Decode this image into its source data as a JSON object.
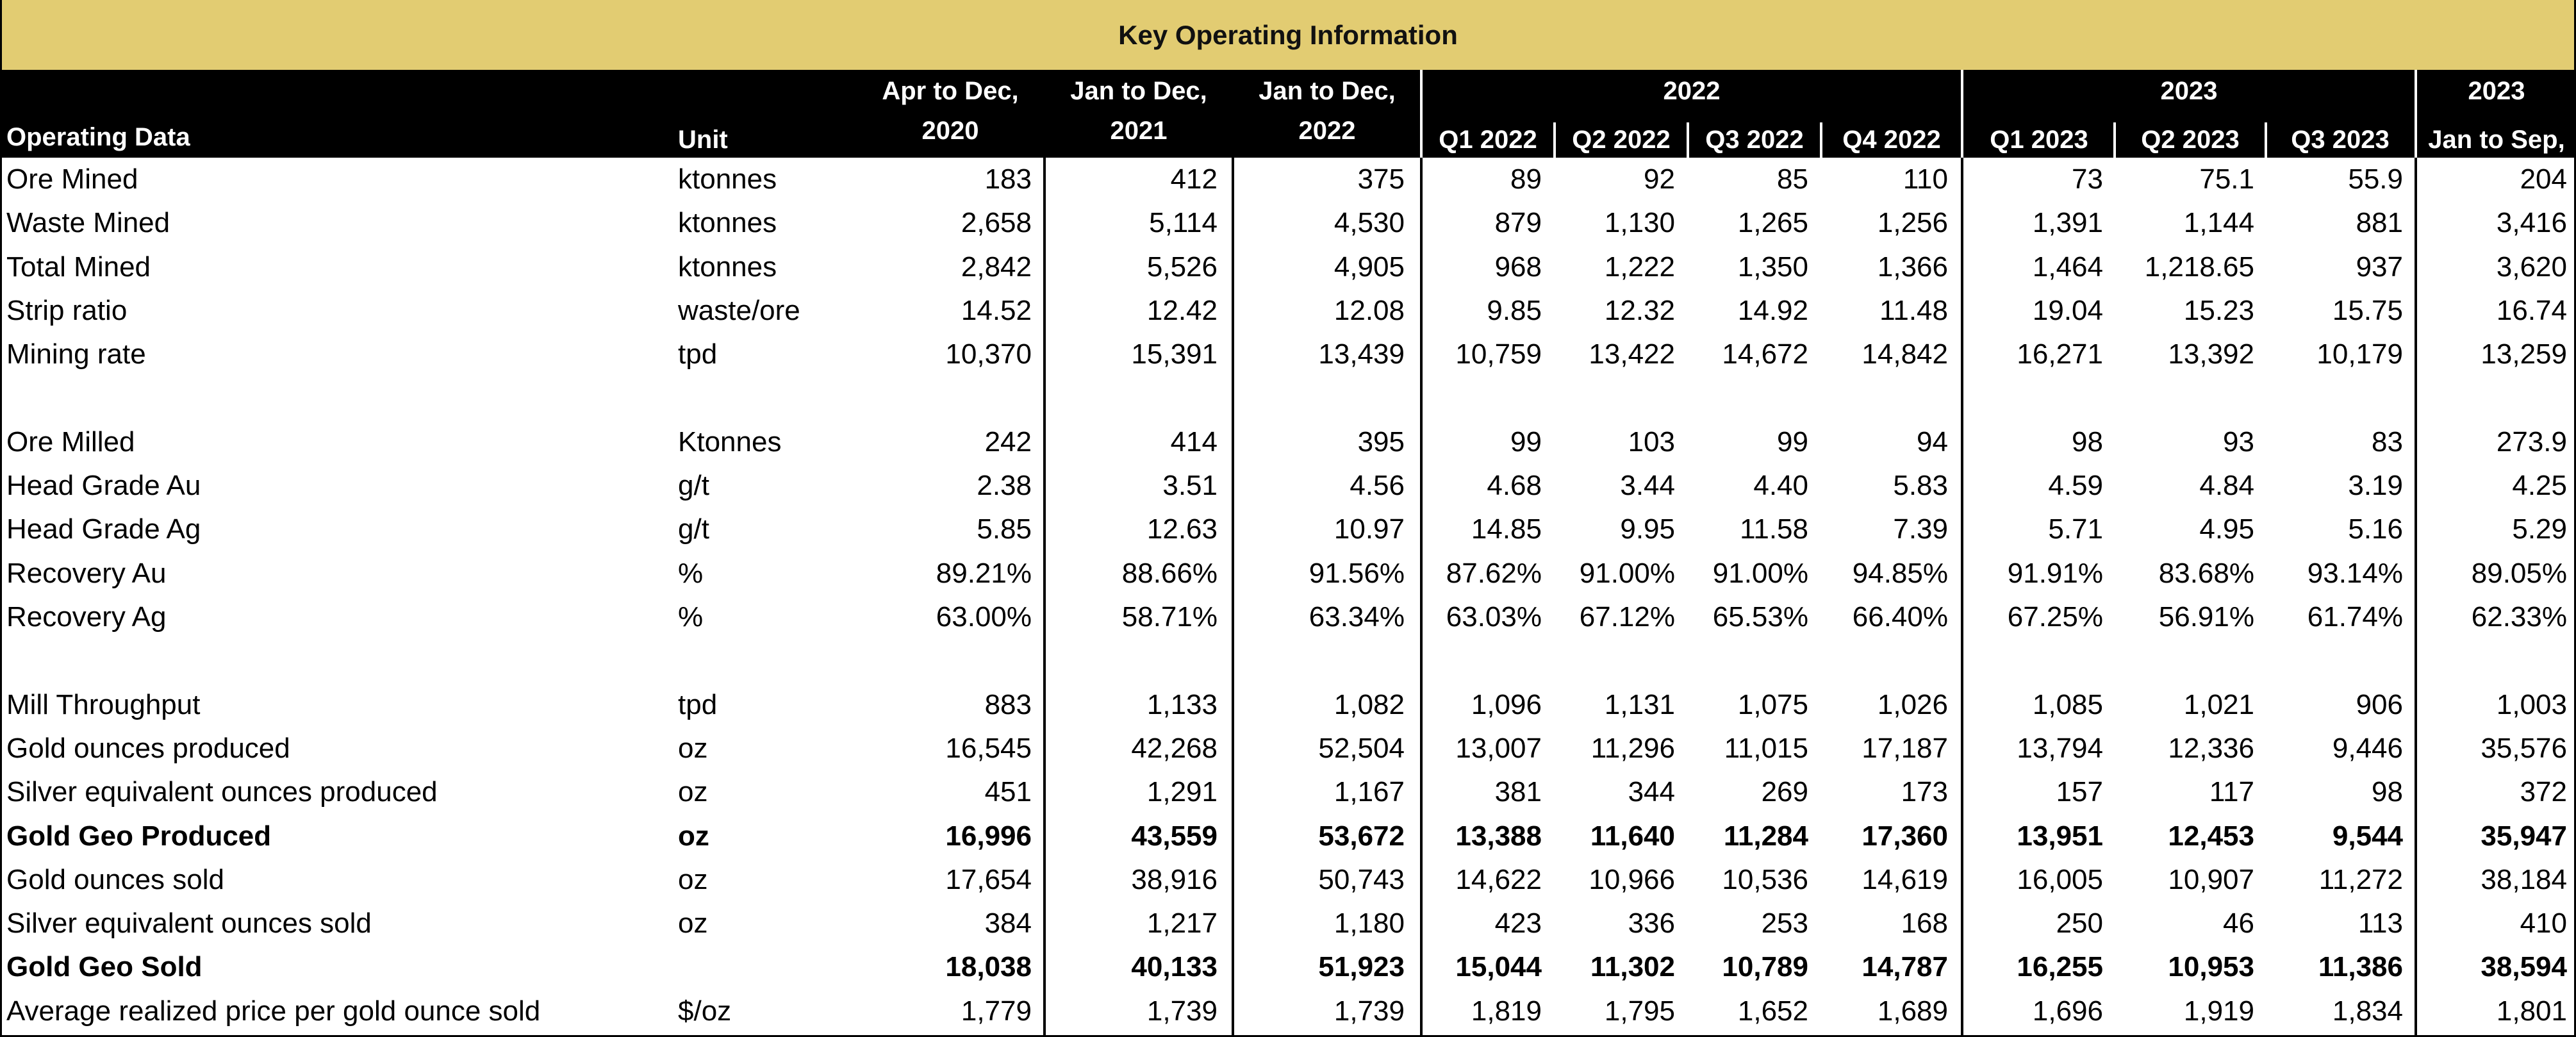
{
  "title": "Key Operating Information",
  "headers": {
    "operating_data": "Operating Data",
    "unit": "Unit",
    "apr_dec_2020": [
      "Apr to Dec,",
      "2020"
    ],
    "jan_dec_2021": [
      "Jan to Dec,",
      "2021"
    ],
    "jan_dec_2022": [
      "Jan to Dec,",
      "2022"
    ],
    "group_2022": "2022",
    "group_2023": "2023",
    "group_2023_ytd": "2023",
    "quarters": [
      "Q1 2022",
      "Q2 2022",
      "Q3 2022",
      "Q4 2022",
      "Q1 2023",
      "Q2 2023",
      "Q3 2023"
    ],
    "jan_sep": "Jan to Sep,"
  },
  "rows": [
    {
      "label": "Ore Mined",
      "unit": "ktonnes",
      "bold": false,
      "values": [
        "183",
        "412",
        "375",
        "89",
        "92",
        "85",
        "110",
        "73",
        "75.1",
        "55.9",
        "204"
      ]
    },
    {
      "label": "Waste Mined",
      "unit": "ktonnes",
      "bold": false,
      "values": [
        "2,658",
        "5,114",
        "4,530",
        "879",
        "1,130",
        "1,265",
        "1,256",
        "1,391",
        "1,144",
        "881",
        "3,416"
      ]
    },
    {
      "label": "Total Mined",
      "unit": "ktonnes",
      "bold": false,
      "values": [
        "2,842",
        "5,526",
        "4,905",
        "968",
        "1,222",
        "1,350",
        "1,366",
        "1,464",
        "1,218.65",
        "937",
        "3,620"
      ]
    },
    {
      "label": "Strip ratio",
      "unit": "waste/ore",
      "bold": false,
      "values": [
        "14.52",
        "12.42",
        "12.08",
        "9.85",
        "12.32",
        "14.92",
        "11.48",
        "19.04",
        "15.23",
        "15.75",
        "16.74"
      ]
    },
    {
      "label": "Mining rate",
      "unit": "tpd",
      "bold": false,
      "values": [
        "10,370",
        "15,391",
        "13,439",
        "10,759",
        "13,422",
        "14,672",
        "14,842",
        "16,271",
        "13,392",
        "10,179",
        "13,259"
      ]
    },
    {
      "label": "",
      "unit": "",
      "bold": false,
      "values": [
        "",
        "",
        "",
        "",
        "",
        "",
        "",
        "",
        "",
        "",
        ""
      ]
    },
    {
      "label": "Ore Milled",
      "unit": "Ktonnes",
      "bold": false,
      "values": [
        "242",
        "414",
        "395",
        "99",
        "103",
        "99",
        "94",
        "98",
        "93",
        "83",
        "273.9"
      ]
    },
    {
      "label": "Head Grade Au",
      "unit": "g/t",
      "bold": false,
      "values": [
        "2.38",
        "3.51",
        "4.56",
        "4.68",
        "3.44",
        "4.40",
        "5.83",
        "4.59",
        "4.84",
        "3.19",
        "4.25"
      ]
    },
    {
      "label": "Head Grade Ag",
      "unit": "g/t",
      "bold": false,
      "values": [
        "5.85",
        "12.63",
        "10.97",
        "14.85",
        "9.95",
        "11.58",
        "7.39",
        "5.71",
        "4.95",
        "5.16",
        "5.29"
      ]
    },
    {
      "label": "Recovery Au",
      "unit": "%",
      "bold": false,
      "values": [
        "89.21%",
        "88.66%",
        "91.56%",
        "87.62%",
        "91.00%",
        "91.00%",
        "94.85%",
        "91.91%",
        "83.68%",
        "93.14%",
        "89.05%"
      ]
    },
    {
      "label": "Recovery Ag",
      "unit": "%",
      "bold": false,
      "values": [
        "63.00%",
        "58.71%",
        "63.34%",
        "63.03%",
        "67.12%",
        "65.53%",
        "66.40%",
        "67.25%",
        "56.91%",
        "61.74%",
        "62.33%"
      ]
    },
    {
      "label": "",
      "unit": "",
      "bold": false,
      "values": [
        "",
        "",
        "",
        "",
        "",
        "",
        "",
        "",
        "",
        "",
        ""
      ]
    },
    {
      "label": "Mill Throughput",
      "unit": "tpd",
      "bold": false,
      "values": [
        "883",
        "1,133",
        "1,082",
        "1,096",
        "1,131",
        "1,075",
        "1,026",
        "1,085",
        "1,021",
        "906",
        "1,003"
      ]
    },
    {
      "label": "Gold ounces produced",
      "unit": "oz",
      "bold": false,
      "values": [
        "16,545",
        "42,268",
        "52,504",
        "13,007",
        "11,296",
        "11,015",
        "17,187",
        "13,794",
        "12,336",
        "9,446",
        "35,576"
      ]
    },
    {
      "label": "Silver equivalent ounces produced",
      "unit": "oz",
      "bold": false,
      "values": [
        "451",
        "1,291",
        "1,167",
        "381",
        "344",
        "269",
        "173",
        "157",
        "117",
        "98",
        "372"
      ]
    },
    {
      "label": "Gold Geo Produced",
      "unit": "oz",
      "bold": true,
      "values": [
        "16,996",
        "43,559",
        "53,672",
        "13,388",
        "11,640",
        "11,284",
        "17,360",
        "13,951",
        "12,453",
        "9,544",
        "35,947"
      ]
    },
    {
      "label": "Gold ounces sold",
      "unit": "oz",
      "bold": false,
      "values": [
        "17,654",
        "38,916",
        "50,743",
        "14,622",
        "10,966",
        "10,536",
        "14,619",
        "16,005",
        "10,907",
        "11,272",
        "38,184"
      ]
    },
    {
      "label": "Silver equivalent ounces sold",
      "unit": "oz",
      "bold": false,
      "values": [
        "384",
        "1,217",
        "1,180",
        "423",
        "336",
        "253",
        "168",
        "250",
        "46",
        "113",
        "410"
      ]
    },
    {
      "label": "Gold Geo Sold",
      "unit": "",
      "bold": true,
      "values": [
        "18,038",
        "40,133",
        "51,923",
        "15,044",
        "11,302",
        "10,789",
        "14,787",
        "16,255",
        "10,953",
        "11,386",
        "38,594"
      ]
    },
    {
      "label": "Average realized price per gold ounce sold",
      "unit": "$/oz",
      "bold": false,
      "values": [
        "1,779",
        "1,739",
        "1,739",
        "1,819",
        "1,795",
        "1,652",
        "1,689",
        "1,696",
        "1,919",
        "1,834",
        "1,801"
      ]
    }
  ]
}
